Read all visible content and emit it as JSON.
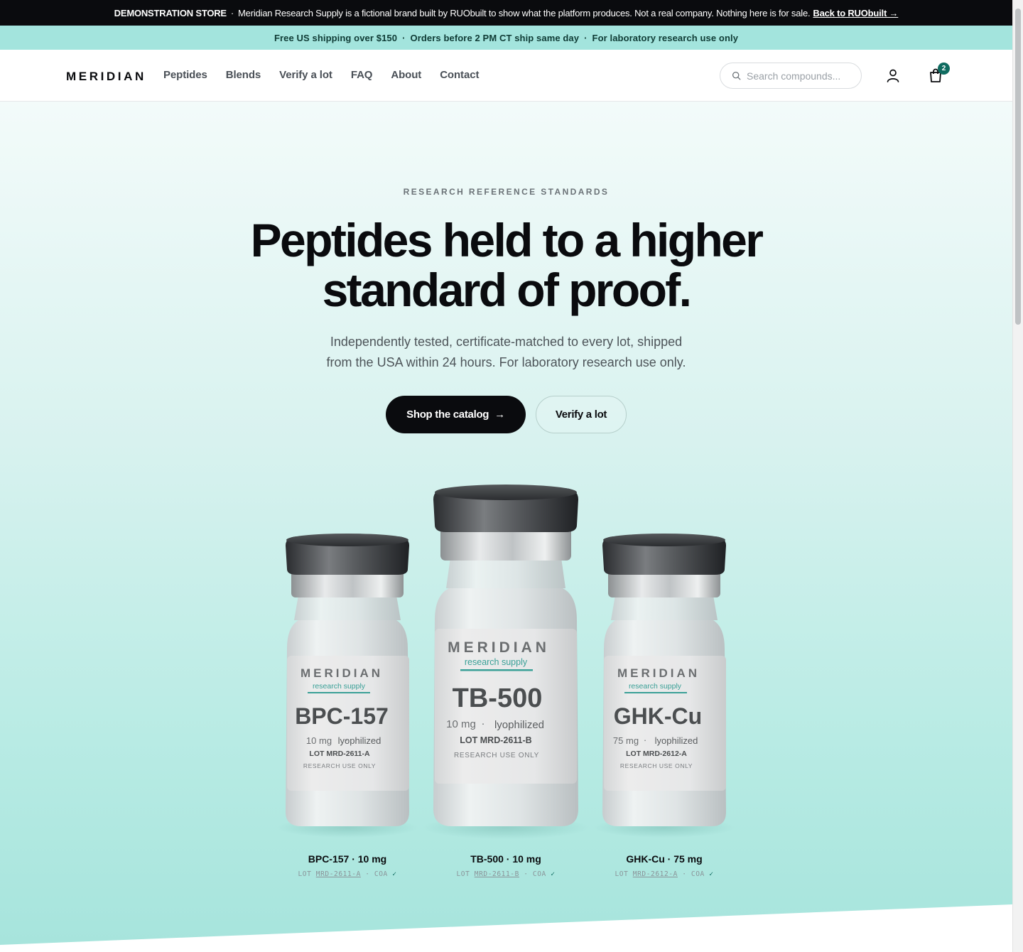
{
  "demo_bar": {
    "tag": "DEMONSTRATION STORE",
    "separator": "·",
    "text": "Meridian Research Supply is a fictional brand built by RUObuilt to show what the platform produces. Not a real company. Nothing here is for sale.",
    "link": "Back to RUObuilt →"
  },
  "ship_bar": {
    "items": [
      "Free US shipping over $150",
      "Orders before 2 PM CT ship same day",
      "For laboratory research use only"
    ],
    "dot": "·"
  },
  "header": {
    "logo": "MERIDIAN",
    "nav": [
      "Peptides",
      "Blends",
      "Verify a lot",
      "FAQ",
      "About",
      "Contact"
    ],
    "search_placeholder": "Search compounds...",
    "cart_count": "2"
  },
  "hero": {
    "eyebrow": "RESEARCH REFERENCE STANDARDS",
    "headline_line1": "Peptides held to a higher",
    "headline_line2": "standard of proof.",
    "sub_line1": "Independently tested, certificate-matched to every lot, shipped",
    "sub_line2": "from the USA within 24 hours. For laboratory research use only.",
    "primary_cta": "Shop the catalog",
    "primary_arrow": "→",
    "secondary_cta": "Verify a lot"
  },
  "vials": [
    {
      "brand": "MERIDIAN",
      "tagline": "research supply",
      "compound": "BPC-157",
      "dose": "10 mg",
      "form": "lyophilized",
      "lot_line": "LOT MRD-2611-A",
      "ruo": "RESEARCH USE ONLY",
      "caption": "BPC-157 · 10 mg",
      "lot_label": "LOT",
      "lot_code": "MRD-2611-A",
      "coa": "COA",
      "check": "✓"
    },
    {
      "brand": "MERIDIAN",
      "tagline": "research supply",
      "compound": "TB-500",
      "dose": "10 mg",
      "form": "lyophilized",
      "lot_line": "LOT MRD-2611-B",
      "ruo": "RESEARCH USE ONLY",
      "caption": "TB-500 · 10 mg",
      "lot_label": "LOT",
      "lot_code": "MRD-2611-B",
      "coa": "COA",
      "check": "✓"
    },
    {
      "brand": "MERIDIAN",
      "tagline": "research supply",
      "compound": "GHK-Cu",
      "dose": "75 mg",
      "form": "lyophilized",
      "lot_line": "LOT MRD-2612-A",
      "ruo": "RESEARCH USE ONLY",
      "caption": "GHK-Cu · 75 mg",
      "lot_label": "LOT",
      "lot_code": "MRD-2612-A",
      "coa": "COA",
      "check": "✓"
    }
  ],
  "colors": {
    "accent": "#0f6b60",
    "mint": "#a3e4dd",
    "ink": "#0a0b0e"
  }
}
